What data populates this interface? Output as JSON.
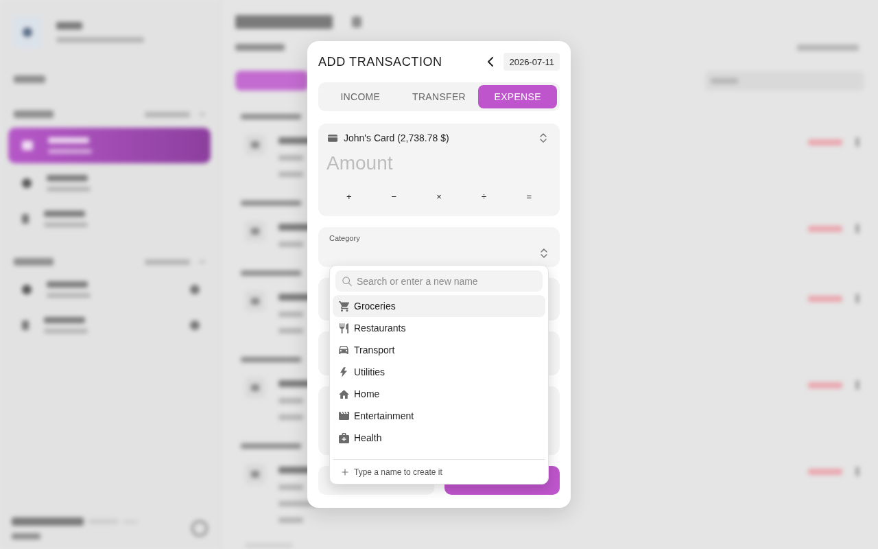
{
  "dialog": {
    "title": "ADD TRANSACTION",
    "date": "2026-07-11",
    "type_tabs": [
      {
        "label": "INCOME",
        "selected": false
      },
      {
        "label": "TRANSFER",
        "selected": false
      },
      {
        "label": "EXPENSE",
        "selected": true
      }
    ],
    "account": {
      "label": "John's Card (2,738.78 $)"
    },
    "amount": {
      "placeholder": "Amount"
    },
    "operator_keys": [
      "+",
      "−",
      "×",
      "÷",
      "="
    ],
    "category": {
      "label": "Category",
      "expanded": true
    },
    "category_menu": {
      "search": {
        "placeholder": "Search or enter a new name"
      },
      "items": [
        {
          "label": "Groceries",
          "selected": true
        },
        {
          "label": "Restaurants",
          "selected": false
        },
        {
          "label": "Transport",
          "selected": false
        },
        {
          "label": "Utilities",
          "selected": false
        },
        {
          "label": "Home",
          "selected": false
        },
        {
          "label": "Entertainment",
          "selected": false
        },
        {
          "label": "Health",
          "selected": false
        }
      ],
      "footer_hint": "Type a name to create it"
    }
  }
}
